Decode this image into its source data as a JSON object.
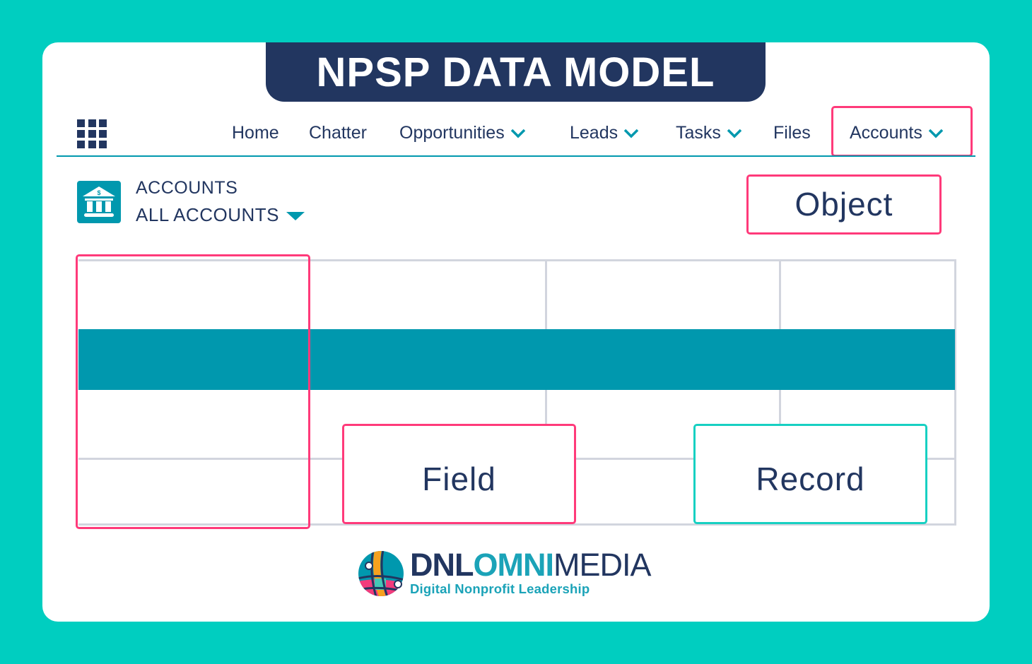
{
  "title": "NPSP DATA MODEL",
  "colors": {
    "background": "#00CEC0",
    "navy": "#223660",
    "accent_teal": "#0098AE",
    "highlight_pink": "#FF3A7A",
    "highlight_teal": "#17D0C2"
  },
  "nav": {
    "app_launcher_icon": "grid-icon",
    "items": [
      {
        "label": "Home",
        "has_dropdown": false
      },
      {
        "label": "Chatter",
        "has_dropdown": false
      },
      {
        "label": "Opportunities",
        "has_dropdown": true
      },
      {
        "label": "Leads",
        "has_dropdown": true
      },
      {
        "label": "Tasks",
        "has_dropdown": true
      },
      {
        "label": "Files",
        "has_dropdown": false
      },
      {
        "label": "Accounts",
        "has_dropdown": true,
        "highlighted": true
      }
    ]
  },
  "object_header": {
    "icon": "bank-icon",
    "object_label": "ACCOUNTS",
    "list_view_label": "ALL ACCOUNTS"
  },
  "annotations": {
    "object": "Object",
    "field": "Field",
    "record": "Record"
  },
  "logo": {
    "part1": "DNL",
    "part2": "OMNI",
    "part3": "MEDIA",
    "tagline": "Digital Nonprofit Leadership"
  }
}
